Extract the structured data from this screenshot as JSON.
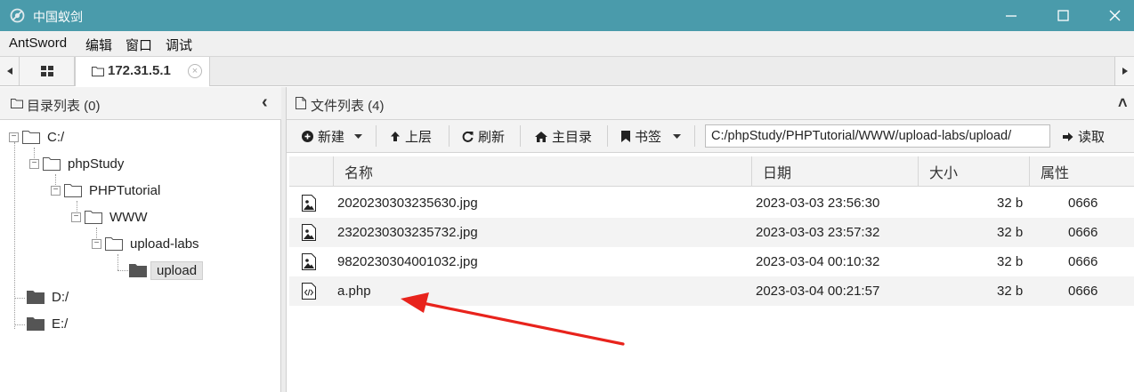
{
  "window": {
    "title": "中国蚁剑",
    "app_icon": "antsword-logo-icon",
    "controls": [
      "minimize-icon",
      "maximize-icon",
      "close-icon"
    ]
  },
  "menubar": {
    "items": [
      "AntSword",
      "编辑",
      "窗口",
      "调试"
    ]
  },
  "tabs": {
    "home_icon": "grid-icon",
    "active_label": "172.31.5.1",
    "close_glyph": "×"
  },
  "left_panel": {
    "title": "目录列表 (0)",
    "collapse_glyph": "‹",
    "tree": [
      {
        "label": "C:/",
        "depth": 0
      },
      {
        "label": "phpStudy",
        "depth": 1
      },
      {
        "label": "PHPTutorial",
        "depth": 2
      },
      {
        "label": "WWW",
        "depth": 3
      },
      {
        "label": "upload-labs",
        "depth": 4
      },
      {
        "label": "upload",
        "depth": 5,
        "selected": true
      },
      {
        "label": "D:/",
        "depth": 0
      },
      {
        "label": "E:/",
        "depth": 0
      }
    ]
  },
  "right_panel": {
    "title": "文件列表 (4)",
    "collapse_glyph": "˄",
    "toolbar": {
      "new_label": "新建",
      "up_label": "上层",
      "refresh_label": "刷新",
      "home_label": "主目录",
      "bookmark_label": "书签",
      "path_value": "C:/phpStudy/PHPTutorial/WWW/upload-labs/upload/",
      "read_label": "读取"
    },
    "columns": [
      "名称",
      "日期",
      "大小",
      "属性"
    ],
    "files": [
      {
        "name": "2020230303235630.jpg",
        "date": "2023-03-03 23:56:30",
        "size": "32 b",
        "attr": "0666",
        "icon": "image-file-icon"
      },
      {
        "name": "2320230303235732.jpg",
        "date": "2023-03-03 23:57:32",
        "size": "32 b",
        "attr": "0666",
        "icon": "image-file-icon"
      },
      {
        "name": "9820230304001032.jpg",
        "date": "2023-03-04 00:10:32",
        "size": "32 b",
        "attr": "0666",
        "icon": "image-file-icon"
      },
      {
        "name": "a.php",
        "date": "2023-03-04 00:21:57",
        "size": "32 b",
        "attr": "0666",
        "icon": "code-file-icon"
      }
    ]
  },
  "annotation": {
    "arrow_color": "#e8231c",
    "points_to": "a.php"
  },
  "colors": {
    "titlebar": "#4a9bab",
    "alt_row": "#f3f3f3"
  }
}
